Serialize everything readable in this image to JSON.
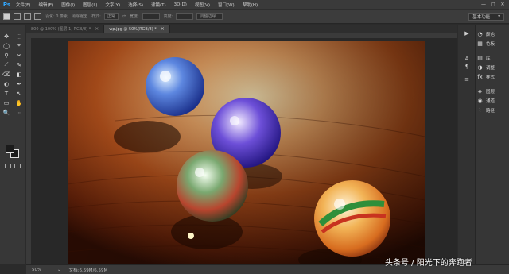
{
  "app": {
    "logo": "Ps"
  },
  "menu": {
    "items": [
      "文件(F)",
      "编辑(E)",
      "图像(I)",
      "图层(L)",
      "文字(Y)",
      "选择(S)",
      "滤镜(T)",
      "3D(D)",
      "视图(V)",
      "窗口(W)",
      "帮助(H)"
    ]
  },
  "window_controls": {
    "minimize": "—",
    "restore": "□",
    "close": "✕"
  },
  "options": {
    "feather_label": "羽化: 0 像素",
    "antialias_label": "消除锯齿",
    "style_label": "样式:",
    "style_value": "正常",
    "width_label": "宽度:",
    "height_label": "高度:",
    "refine_edge": "调整边缘...",
    "workspace": "基本功能",
    "workspace_arrow": "▾"
  },
  "tabs": [
    {
      "label": "800 @ 100% (图层 1, RGB/8) *",
      "close": "×"
    },
    {
      "label": "wp.jpg @ 50%(RGB/8) *",
      "close": "×"
    }
  ],
  "tools": [
    "✥",
    "⬚",
    "◯",
    "⌖",
    "⚲",
    "✂",
    "⟋",
    "✎",
    "⌫",
    "◧",
    "◐",
    "✒",
    "T",
    "↖",
    "▭",
    "✋",
    "🔍",
    "⋯"
  ],
  "panels": [
    {
      "icon": "◔",
      "label": "颜色"
    },
    {
      "icon": "▦",
      "label": "色板"
    },
    {
      "icon": "▤",
      "label": "库"
    },
    {
      "icon": "◑",
      "label": "调整"
    },
    {
      "icon": "fx",
      "label": "样式"
    },
    {
      "icon": "◈",
      "label": "图层"
    },
    {
      "icon": "◉",
      "label": "通道"
    },
    {
      "icon": "⌇",
      "label": "路径"
    }
  ],
  "dock_icons": [
    "▶",
    "A",
    "¶",
    "≡"
  ],
  "status": {
    "zoom": "50%",
    "doc": "文档:6.59M/6.59M"
  },
  "watermark": "头条号 / 阳光下的奔跑者",
  "colors": {
    "accent": "#31a8ff",
    "ui_dark": "#2b2b2b",
    "photo_wood": "#8a3b12"
  }
}
